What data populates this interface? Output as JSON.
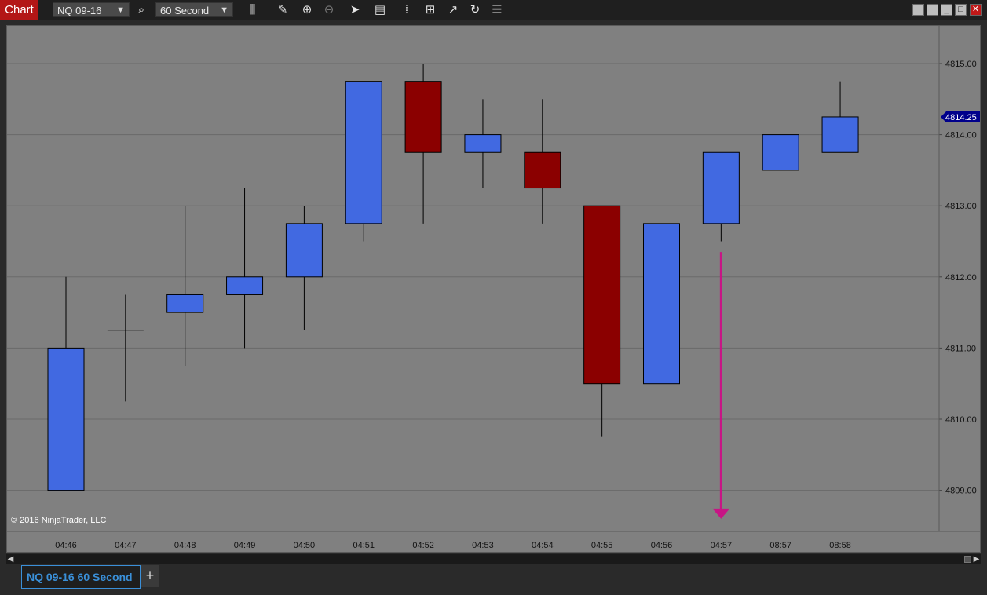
{
  "toolbar": {
    "chart_tab_label": "Chart",
    "instrument": "NQ 09-16",
    "interval": "60 Second",
    "icons": [
      "search-icon",
      "bar-type-icon",
      "draw-pencil-icon",
      "zoom-in-icon",
      "zoom-out-icon",
      "pointer-icon",
      "data-box-icon",
      "chart-style-icon",
      "strategies-icon",
      "indicators-icon",
      "reload-icon",
      "properties-icon"
    ]
  },
  "window_controls": [
    "tile-icon",
    "tile-icon",
    "minimize-icon",
    "maximize-icon",
    "close-icon"
  ],
  "chart_data": {
    "type": "candlestick",
    "x": [
      "04:46",
      "04:47",
      "04:48",
      "04:49",
      "04:50",
      "04:51",
      "04:52",
      "04:53",
      "04:54",
      "04:55",
      "04:56",
      "04:57",
      "08:57",
      "08:58"
    ],
    "candles": [
      {
        "time": "04:46",
        "open": 4809.0,
        "high": 4812.0,
        "low": 4809.0,
        "close": 4811.0
      },
      {
        "time": "04:47",
        "open": 4811.25,
        "high": 4811.75,
        "low": 4810.25,
        "close": 4811.25
      },
      {
        "time": "04:48",
        "open": 4811.5,
        "high": 4813.0,
        "low": 4810.75,
        "close": 4811.75
      },
      {
        "time": "04:49",
        "open": 4811.75,
        "high": 4813.25,
        "low": 4811.0,
        "close": 4812.0
      },
      {
        "time": "04:50",
        "open": 4812.0,
        "high": 4813.0,
        "low": 4811.25,
        "close": 4812.75
      },
      {
        "time": "04:51",
        "open": 4812.75,
        "high": 4814.75,
        "low": 4812.5,
        "close": 4814.75
      },
      {
        "time": "04:52",
        "open": 4814.75,
        "high": 4815.0,
        "low": 4812.75,
        "close": 4813.75
      },
      {
        "time": "04:53",
        "open": 4813.75,
        "high": 4814.5,
        "low": 4813.25,
        "close": 4814.0
      },
      {
        "time": "04:54",
        "open": 4813.75,
        "high": 4814.5,
        "low": 4812.75,
        "close": 4813.25
      },
      {
        "time": "04:55",
        "open": 4813.0,
        "high": 4813.0,
        "low": 4809.75,
        "close": 4810.5
      },
      {
        "time": "04:56",
        "open": 4810.5,
        "high": 4812.75,
        "low": 4810.5,
        "close": 4812.75
      },
      {
        "time": "04:57",
        "open": 4812.75,
        "high": 4813.75,
        "low": 4812.5,
        "close": 4813.75
      },
      {
        "time": "08:57",
        "open": 4813.5,
        "high": 4814.0,
        "low": 4813.5,
        "close": 4814.0
      },
      {
        "time": "08:58",
        "open": 4813.75,
        "high": 4814.75,
        "low": 4813.75,
        "close": 4814.25
      }
    ],
    "y_ticks": [
      "4815.00",
      "4814.00",
      "4813.00",
      "4812.00",
      "4811.00",
      "4810.00",
      "4809.00"
    ],
    "ylim": [
      4808.5,
      4815.5
    ],
    "last_price_label": "4814.25",
    "colors": {
      "up": "#4169e1",
      "down": "#8b0000",
      "wick": "#000000",
      "background": "#808080",
      "grid": "#6a6a6a",
      "last_price": "#00008b",
      "annotation_arrow": "#c71585"
    },
    "annotation": {
      "type": "down-arrow",
      "at": "04:57",
      "from_price": 4812.35,
      "to_price": 4808.6
    },
    "grid": true
  },
  "copyright": "© 2016 NinjaTrader, LLC",
  "bottom_tabs": [
    {
      "label": "NQ 09-16 60 Second"
    }
  ],
  "add_tab_label": "+"
}
